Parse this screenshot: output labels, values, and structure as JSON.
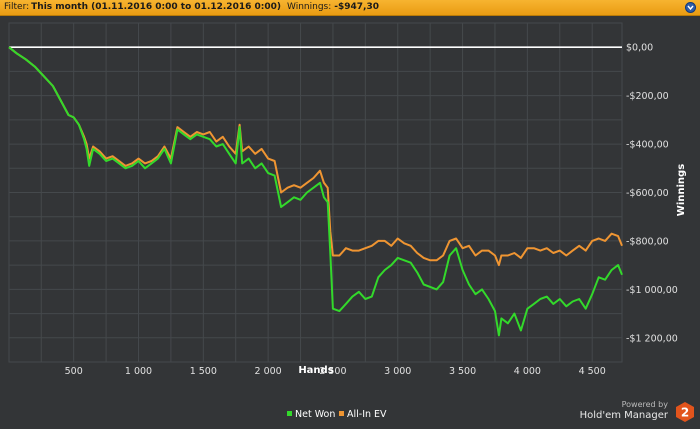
{
  "filter": {
    "label": "Filter:",
    "value": "This month (01.11.2016 0:00 to 01.12.2016 0:00)",
    "winnings_label": "Winnings:",
    "winnings_value": "-$947,30"
  },
  "colors": {
    "background": "#333537",
    "grid": "#45494c",
    "zero_line": "#ffffff",
    "net_won": "#33d92b",
    "all_in_ev": "#ef9532",
    "filter_bar": "#f3a823"
  },
  "branding": {
    "powered_by": "Powered by",
    "product": "Hold'em Manager",
    "logo_text": "2"
  },
  "chart_data": {
    "type": "line",
    "title": "",
    "xlabel": "Hands",
    "ylabel": "Winnings",
    "xlim": [
      1,
      4730
    ],
    "ylim": [
      -1300,
      100
    ],
    "x_ticks": [
      500,
      1000,
      1500,
      2000,
      2500,
      3000,
      3500,
      4000,
      4500
    ],
    "x_tick_labels": [
      "500",
      "1 000",
      "1 500",
      "2 000",
      "2 500",
      "3 000",
      "3 500",
      "4 000",
      "4 500"
    ],
    "y_ticks": [
      0,
      -200,
      -400,
      -600,
      -800,
      -1000,
      -1200
    ],
    "y_tick_labels": [
      "$0,00",
      "-$200,00",
      "-$400,00",
      "-$600,00",
      "-$800,00",
      "-$1 000,00",
      "-$1 200,00"
    ],
    "grid": true,
    "legend_position": "bottom-center",
    "series": [
      {
        "name": "Net Won",
        "color": "#33d92b",
        "x": [
          1,
          60,
          130,
          200,
          270,
          340,
          410,
          460,
          500,
          540,
          580,
          600,
          620,
          650,
          700,
          750,
          800,
          850,
          900,
          950,
          1000,
          1050,
          1100,
          1150,
          1200,
          1250,
          1300,
          1350,
          1400,
          1450,
          1500,
          1550,
          1600,
          1650,
          1700,
          1750,
          1780,
          1800,
          1850,
          1900,
          1950,
          2000,
          2050,
          2100,
          2150,
          2200,
          2250,
          2300,
          2350,
          2400,
          2430,
          2460,
          2480,
          2500,
          2550,
          2600,
          2650,
          2700,
          2750,
          2800,
          2850,
          2900,
          2950,
          3000,
          3050,
          3100,
          3150,
          3200,
          3250,
          3300,
          3350,
          3400,
          3450,
          3500,
          3550,
          3600,
          3650,
          3700,
          3750,
          3780,
          3800,
          3850,
          3900,
          3950,
          4000,
          4050,
          4100,
          4150,
          4200,
          4250,
          4300,
          4350,
          4400,
          4450,
          4500,
          4550,
          4600,
          4650,
          4700,
          4730
        ],
        "y": [
          0,
          -25,
          -50,
          -80,
          -120,
          -160,
          -230,
          -280,
          -290,
          -320,
          -380,
          -420,
          -490,
          -420,
          -440,
          -470,
          -460,
          -480,
          -500,
          -490,
          -470,
          -500,
          -480,
          -460,
          -420,
          -480,
          -340,
          -360,
          -380,
          -360,
          -370,
          -380,
          -410,
          -400,
          -440,
          -480,
          -330,
          -480,
          -460,
          -500,
          -480,
          -520,
          -530,
          -660,
          -640,
          -620,
          -630,
          -600,
          -580,
          -560,
          -620,
          -640,
          -850,
          -1080,
          -1090,
          -1060,
          -1030,
          -1010,
          -1040,
          -1030,
          -950,
          -920,
          -900,
          -870,
          -880,
          -890,
          -930,
          -980,
          -990,
          -1000,
          -970,
          -860,
          -830,
          -920,
          -980,
          -1020,
          -1000,
          -1040,
          -1090,
          -1190,
          -1120,
          -1140,
          -1100,
          -1170,
          -1080,
          -1060,
          -1040,
          -1030,
          -1060,
          -1040,
          -1070,
          -1050,
          -1040,
          -1080,
          -1020,
          -950,
          -960,
          -920,
          -900,
          -940
        ]
      },
      {
        "name": "All-In EV",
        "color": "#ef9532",
        "x": [
          1,
          60,
          130,
          200,
          270,
          340,
          410,
          460,
          500,
          540,
          580,
          600,
          620,
          650,
          700,
          750,
          800,
          850,
          900,
          950,
          1000,
          1050,
          1100,
          1150,
          1200,
          1250,
          1300,
          1350,
          1400,
          1450,
          1500,
          1550,
          1600,
          1650,
          1700,
          1750,
          1780,
          1800,
          1850,
          1900,
          1950,
          2000,
          2050,
          2100,
          2150,
          2200,
          2250,
          2300,
          2350,
          2400,
          2430,
          2460,
          2480,
          2500,
          2550,
          2600,
          2650,
          2700,
          2750,
          2800,
          2850,
          2900,
          2950,
          3000,
          3050,
          3100,
          3150,
          3200,
          3250,
          3300,
          3350,
          3400,
          3450,
          3500,
          3550,
          3600,
          3650,
          3700,
          3750,
          3780,
          3800,
          3850,
          3900,
          3950,
          4000,
          4050,
          4100,
          4150,
          4200,
          4250,
          4300,
          4350,
          4400,
          4450,
          4500,
          4550,
          4600,
          4650,
          4700,
          4730
        ],
        "y": [
          0,
          -25,
          -50,
          -80,
          -120,
          -160,
          -230,
          -280,
          -290,
          -320,
          -370,
          -400,
          -460,
          -410,
          -430,
          -460,
          -450,
          -470,
          -490,
          -480,
          -460,
          -480,
          -470,
          -450,
          -410,
          -460,
          -330,
          -350,
          -370,
          -350,
          -360,
          -350,
          -390,
          -370,
          -410,
          -440,
          -320,
          -430,
          -410,
          -440,
          -420,
          -460,
          -470,
          -600,
          -580,
          -570,
          -580,
          -560,
          -540,
          -510,
          -560,
          -580,
          -760,
          -860,
          -860,
          -830,
          -840,
          -840,
          -830,
          -820,
          -800,
          -800,
          -820,
          -790,
          -810,
          -820,
          -850,
          -870,
          -880,
          -880,
          -860,
          -800,
          -790,
          -830,
          -820,
          -860,
          -840,
          -840,
          -860,
          -900,
          -860,
          -860,
          -850,
          -870,
          -830,
          -830,
          -840,
          -830,
          -850,
          -840,
          -860,
          -840,
          -820,
          -840,
          -800,
          -790,
          -800,
          -770,
          -780,
          -820
        ]
      }
    ]
  }
}
